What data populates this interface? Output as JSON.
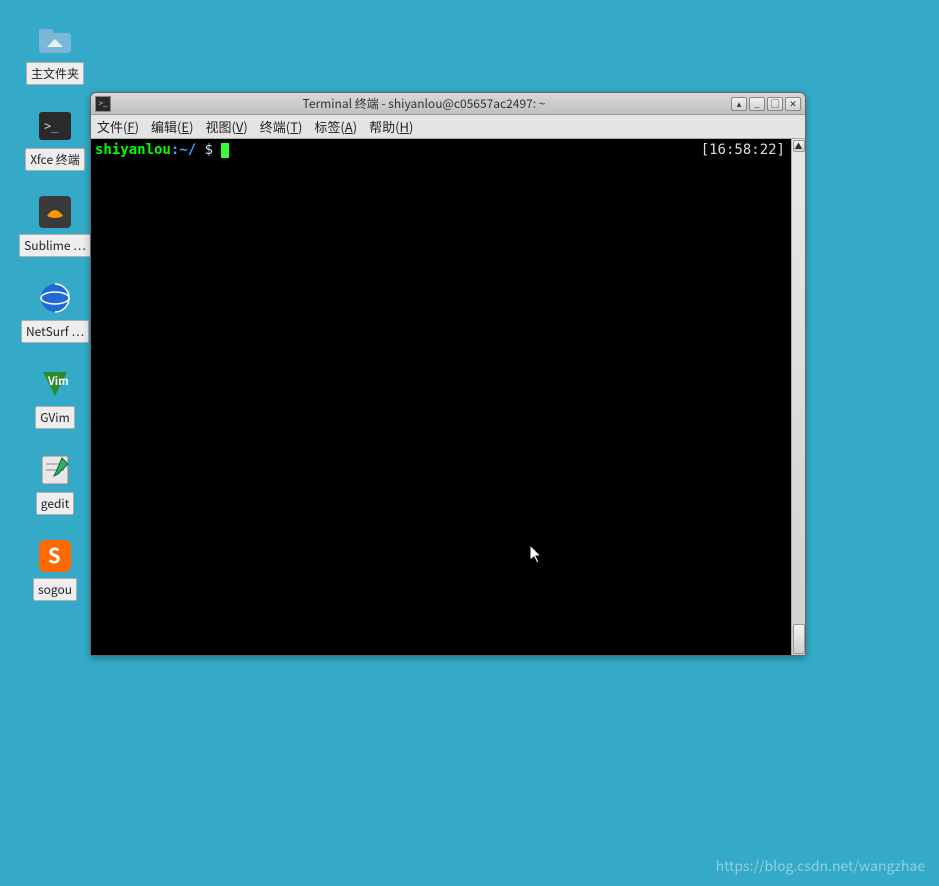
{
  "desktop": {
    "icons": [
      {
        "name": "home-folder",
        "label": "主文件夹",
        "iconColor": "#7db7d8",
        "glyph": "home"
      },
      {
        "name": "xfce-terminal",
        "label": "Xfce 终端",
        "iconColor": "#2a2a2a",
        "glyph": "term"
      },
      {
        "name": "sublime",
        "label": "Sublime …",
        "iconColor": "#3a3a3a",
        "glyph": "subl"
      },
      {
        "name": "netsurf",
        "label": "NetSurf …",
        "iconColor": "#1f6ad6",
        "glyph": "globe"
      },
      {
        "name": "gvim",
        "label": "GVim",
        "iconColor": "#2b8a2b",
        "glyph": "vim"
      },
      {
        "name": "gedit",
        "label": "gedit",
        "iconColor": "#e8e8e8",
        "glyph": "note"
      },
      {
        "name": "sogou",
        "label": "sogou",
        "iconColor": "#ff6a00",
        "glyph": "S"
      }
    ]
  },
  "window": {
    "title": "Terminal 终端 - shiyanlou@c05657ac2497: ~",
    "menus": [
      {
        "label": "文件",
        "key": "F"
      },
      {
        "label": "编辑",
        "key": "E"
      },
      {
        "label": "视图",
        "key": "V"
      },
      {
        "label": "终端",
        "key": "T"
      },
      {
        "label": "标签",
        "key": "A"
      },
      {
        "label": "帮助",
        "key": "H"
      }
    ],
    "buttons": {
      "rollup": "▴",
      "min": "_",
      "max": "□",
      "close": "✕"
    }
  },
  "terminal": {
    "user": "shiyanlou",
    "path": "~/",
    "symbol": "$",
    "clock": "[16:58:22]"
  },
  "watermark": "https://blog.csdn.net/wangzhae"
}
